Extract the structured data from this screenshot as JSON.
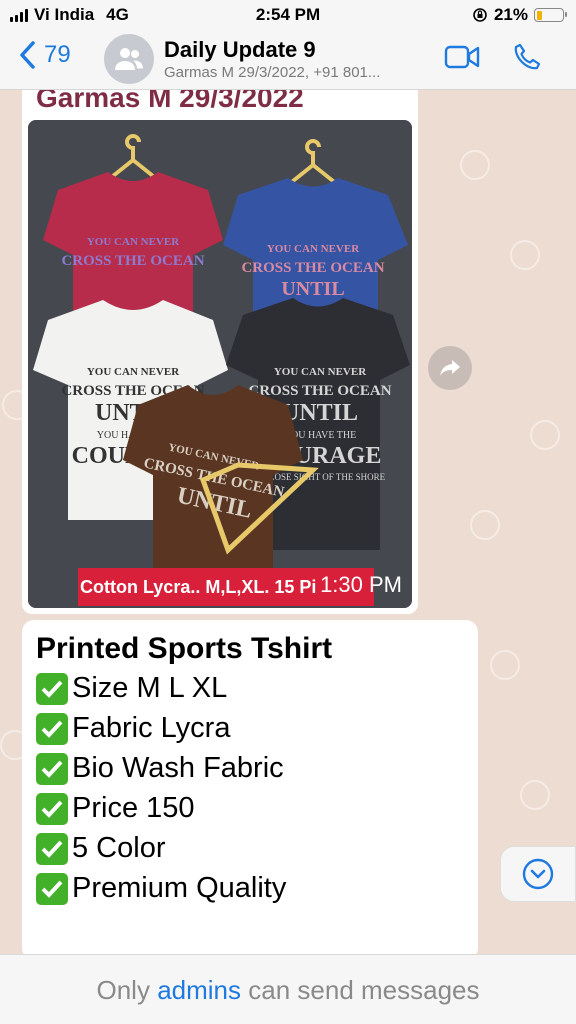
{
  "status_bar": {
    "carrier": "Vi India",
    "network": "4G",
    "time": "2:54 PM",
    "battery": "21%",
    "battery_level": 0.21
  },
  "header": {
    "back_count": "79",
    "title": "Daily Update 9",
    "subtitle": "Garmas M 29/3/2022, +91 801..."
  },
  "message1": {
    "sender": "Garmas M 29/3/2022",
    "caption": "Cotton Lycra.. M,L,XL. 15 Pi",
    "time": "1:30 PM"
  },
  "message2": {
    "lines": [
      "Printed Sports Tshirt",
      "Size M  L XL",
      "Fabric Lycra",
      "Bio Wash Fabric",
      "Price 150",
      "5 Color",
      "Premium  Quality"
    ]
  },
  "footer": {
    "text_before": "Only",
    "admins": "admins",
    "text_after": "can send messages"
  },
  "colors": {
    "accent": "#1f7ae0",
    "check_green": "#43b02a",
    "caption_red": "#d8203a",
    "chat_bg": "#eddcd2"
  },
  "shirts": {
    "print_top": "YOU CAN NEVER",
    "print_mid": "CROSS THE OCEAN",
    "print_until": "UNTIL",
    "print_small": "YOU HAVE THE",
    "print_big": "COURAGE",
    "print_bottom": "TO LOSE SIGHT OF THE SHORE"
  },
  "icons": [
    "chevron-left-icon",
    "group-avatar-icon",
    "video-call-icon",
    "phone-icon",
    "forward-icon",
    "chevron-down-circle-icon",
    "checkmark-icon"
  ]
}
